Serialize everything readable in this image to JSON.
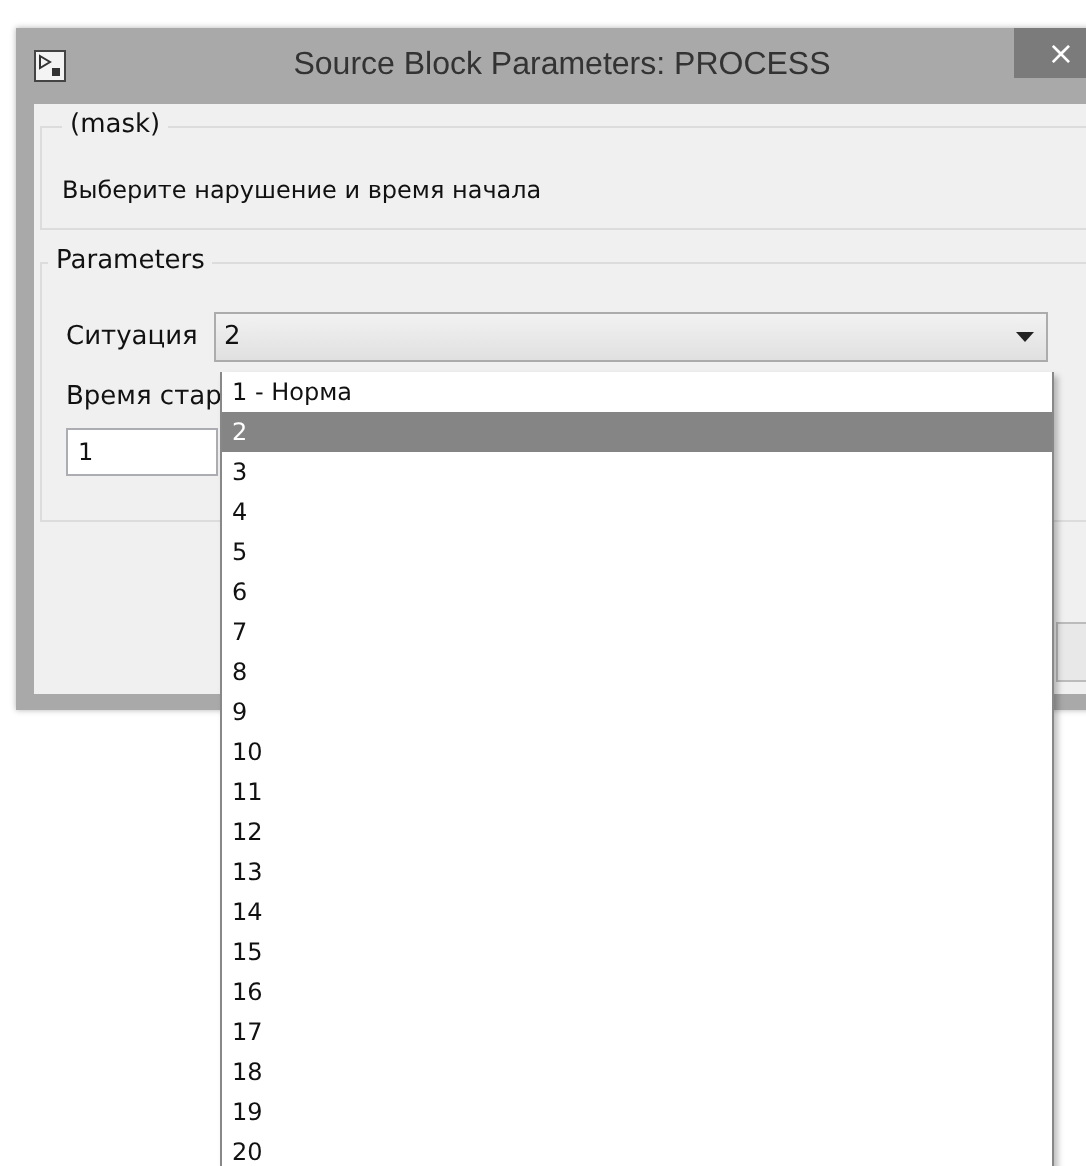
{
  "window": {
    "title": "Source Block Parameters: PROCESS",
    "close": "×"
  },
  "mask_group": {
    "title": "(mask)",
    "description": "Выберите нарушение и время начала"
  },
  "parameters": {
    "title": "Parameters",
    "situation": {
      "label": "Ситуация",
      "value": "2",
      "options": [
        {
          "label": "1 - Норма",
          "selected": false
        },
        {
          "label": "2",
          "selected": true
        },
        {
          "label": "3",
          "selected": false
        },
        {
          "label": "4",
          "selected": false
        },
        {
          "label": "5",
          "selected": false
        },
        {
          "label": "6",
          "selected": false
        },
        {
          "label": "7",
          "selected": false
        },
        {
          "label": "8",
          "selected": false
        },
        {
          "label": "9",
          "selected": false
        },
        {
          "label": "10",
          "selected": false
        },
        {
          "label": "11",
          "selected": false
        },
        {
          "label": "12",
          "selected": false
        },
        {
          "label": "13",
          "selected": false
        },
        {
          "label": "14",
          "selected": false
        },
        {
          "label": "15",
          "selected": false
        },
        {
          "label": "16",
          "selected": false
        },
        {
          "label": "17",
          "selected": false
        },
        {
          "label": "18",
          "selected": false
        },
        {
          "label": "19",
          "selected": false
        },
        {
          "label": "20",
          "selected": false
        }
      ]
    },
    "start_time": {
      "label": "Время стар",
      "value": "1"
    }
  }
}
